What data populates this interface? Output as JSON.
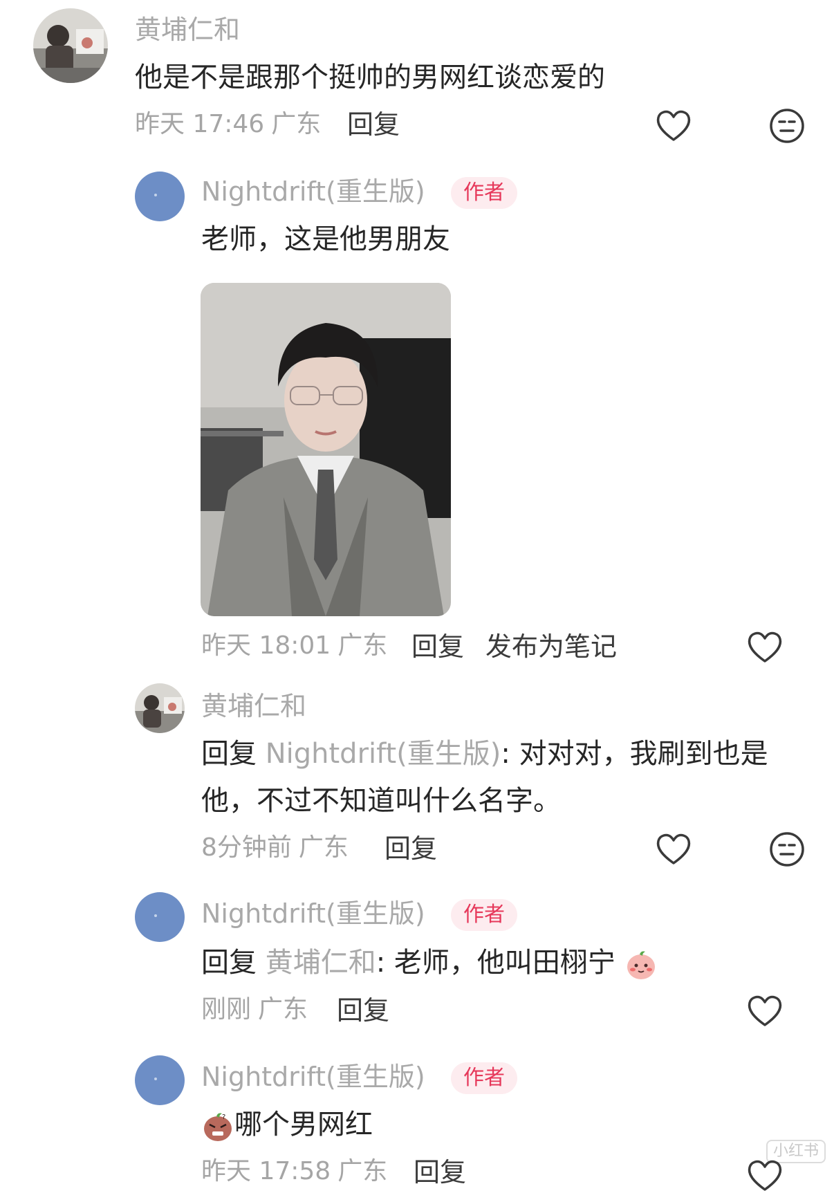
{
  "comments": [
    {
      "user": "黄埔仁和",
      "text": "他是不是跟那个挺帅的男网红谈恋爱的",
      "time": "昨天 17:46",
      "location": "广东",
      "reply_label": "回复"
    }
  ],
  "replies": [
    {
      "user": "Nightdrift(重生版)",
      "badge": "作者",
      "text": "老师，这是他男朋友",
      "time": "昨天 18:01",
      "location": "广东",
      "reply_label": "回复",
      "publish_label": "发布为笔记"
    },
    {
      "user": "黄埔仁和",
      "reply_prefix": "回复",
      "mention": "Nightdrift(重生版)",
      "text_line1": ": 对对对，我刷到也是",
      "text_line2": "他，不过不知道叫什么名字。",
      "time": "8分钟前",
      "location": "广东",
      "reply_label": "回复"
    },
    {
      "user": "Nightdrift(重生版)",
      "badge": "作者",
      "reply_prefix": "回复",
      "mention": "黄埔仁和",
      "text": ": 老师，他叫田栩宁",
      "time": "刚刚",
      "location": "广东",
      "reply_label": "回复"
    },
    {
      "user": "Nightdrift(重生版)",
      "badge": "作者",
      "text": "哪个男网红",
      "time": "昨天 17:58",
      "location": "广东",
      "reply_label": "回复"
    }
  ],
  "watermark": "小红书",
  "colors": {
    "badge_bg": "#fdecef",
    "badge_text": "#e6385a",
    "muted": "#a9a9a9"
  }
}
